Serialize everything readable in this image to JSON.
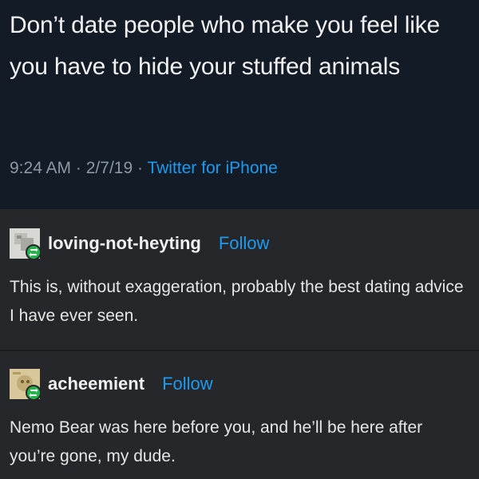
{
  "tweet": {
    "text": "Don’t date people who make you feel like you have to hide your stuffed animals",
    "time": "9:24 AM",
    "sep1": "·",
    "date": "2/7/19",
    "sep2": "·",
    "source": "Twitter for iPhone"
  },
  "posts": [
    {
      "username": "loving-not-heyting",
      "follow_label": "Follow",
      "body": "This is, without exaggeration, probably the best dating advice I have ever seen.",
      "avatar_icon": "avatar-icon",
      "badge_icon": "reblog-icon"
    },
    {
      "username": "acheemient",
      "follow_label": "Follow",
      "body": "Nemo Bear was here before you, and he’ll be here after you’re gone, my dude.",
      "avatar_icon": "avatar-icon",
      "badge_icon": "reblog-icon"
    }
  ],
  "colors": {
    "tweet_bg": "#121b26",
    "post_bg": "#26272a",
    "link": "#1d9bf0",
    "meta": "#8b98a5",
    "badge": "#27b34b"
  }
}
